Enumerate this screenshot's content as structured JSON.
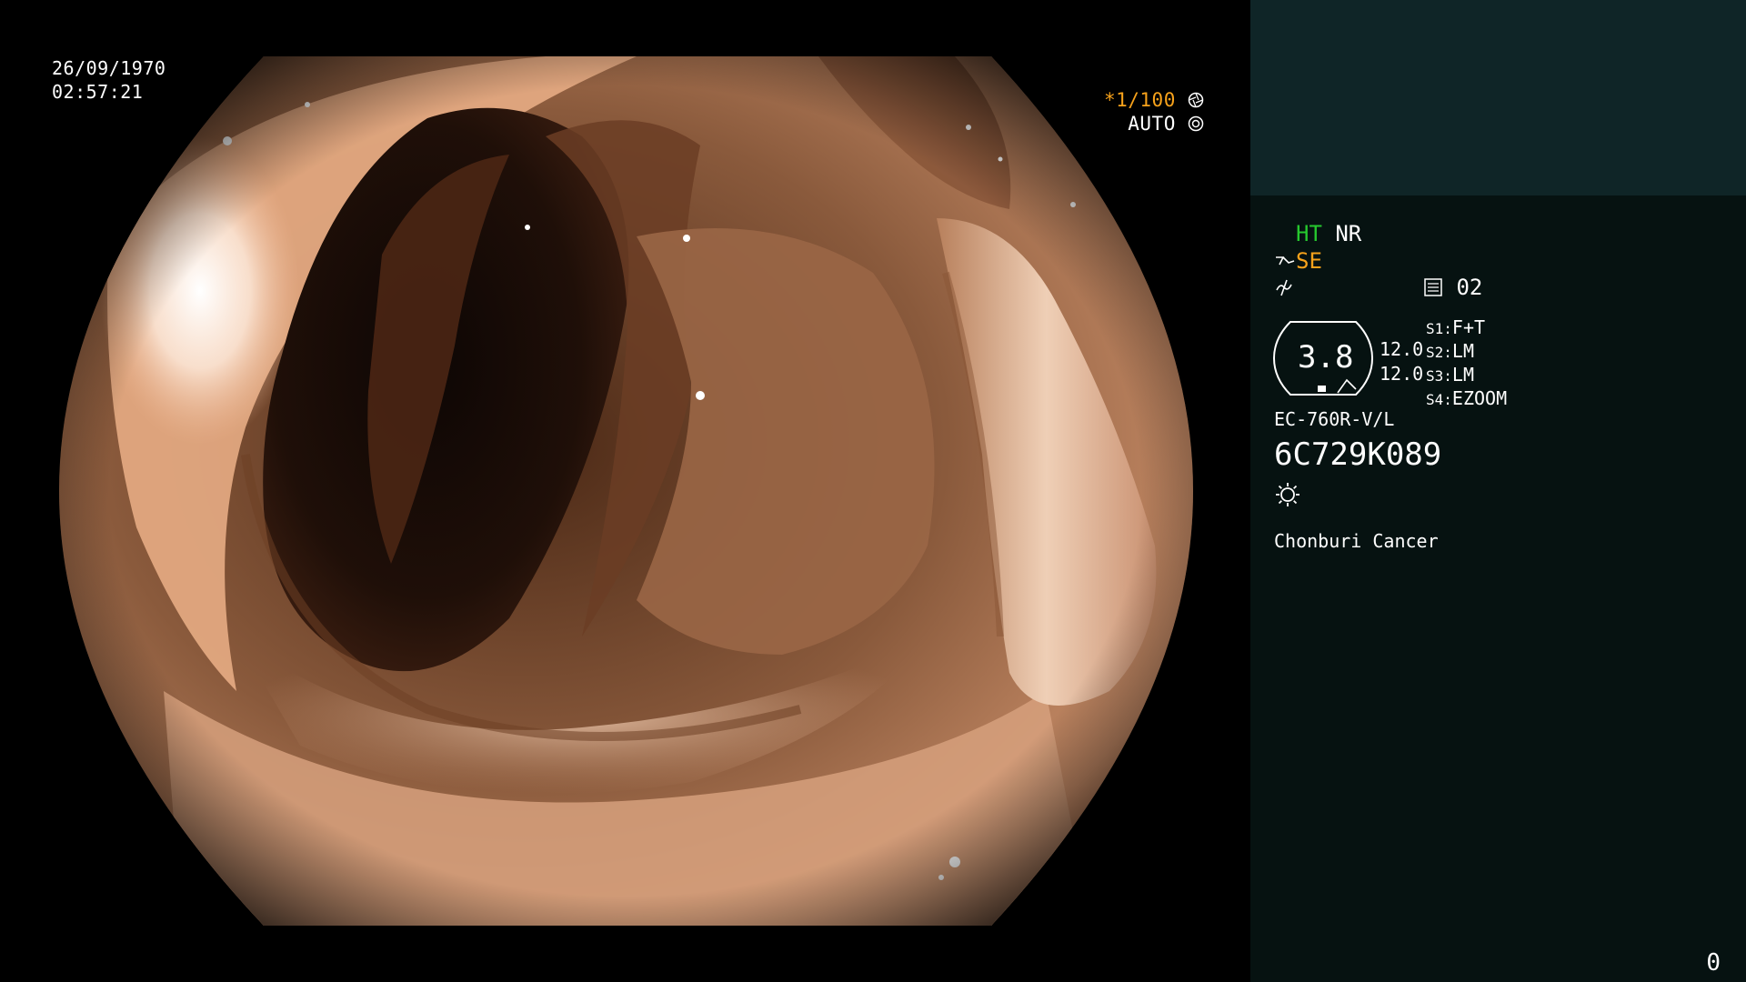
{
  "overlay": {
    "date": "26/09/1970",
    "time": "02:57:21",
    "shutter_prefix": "*",
    "shutter_value": "1/100",
    "iris_mode": "AUTO"
  },
  "panel": {
    "ht": "HT",
    "nr": "NR",
    "se": "SE",
    "memory_slot": "02",
    "ring_value": "3.8",
    "level_a": "12.0",
    "level_b": "12.0",
    "switches": [
      {
        "key": "S1",
        "value": "F+T"
      },
      {
        "key": "S2",
        "value": "LM"
      },
      {
        "key": "S3",
        "value": "LM"
      },
      {
        "key": "S4",
        "value": "EZOOM"
      }
    ],
    "scope_model": "EC-760R-V/L",
    "scope_serial": "6C729K089",
    "institution": "Chonburi Cancer",
    "counter": "0"
  },
  "colors": {
    "panel_top": "#0f2527",
    "panel_body": "#061211",
    "green": "#26c82e",
    "orange": "#f7a21b",
    "mucosa_light": "#e9b591",
    "mucosa_dark": "#3a1d10"
  },
  "icons": [
    "aperture-icon",
    "iris-icon",
    "scissors-icon",
    "tilde-icon",
    "memory-icon",
    "light-icon"
  ]
}
